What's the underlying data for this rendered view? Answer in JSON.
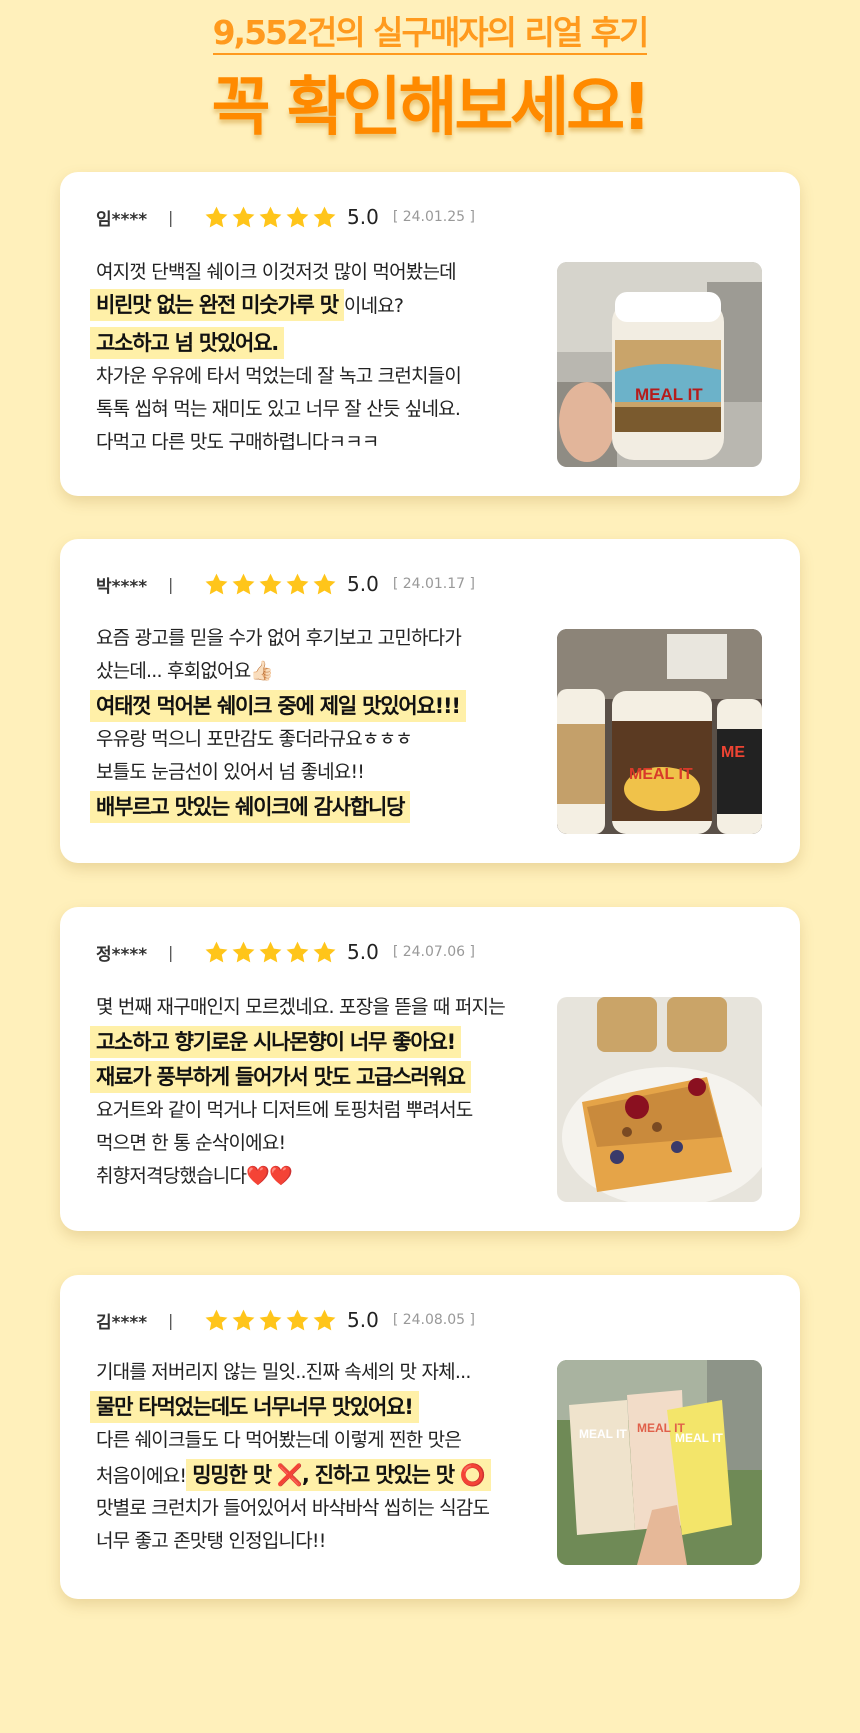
{
  "header": {
    "subtitle": "9,552건의 실구매자의 리얼 후기",
    "title": "꼭 확인해보세요!"
  },
  "colors": {
    "accent": "#ff9a1e",
    "highlight": "#fff0a8",
    "star": "#ffc51a",
    "background": "#fff0bb"
  },
  "reviews": [
    {
      "author": "임****",
      "separator": "|",
      "rating": "5.0",
      "stars": 5,
      "date": "[ 24.01.25 ]",
      "lines": [
        "여지껏 단백질 쉐이크 이것저것 많이 먹어봤는데",
        "비린맛 없는 완전 미숫가루 맛",
        "이네요?",
        "고소하고 넘 맛있어요.",
        "차가운 우유에 타서 먹었는데 잘 녹고 크런치들이",
        "톡톡 씹혀 먹는 재미도 있고 너무 잘 산듯 싶네요.",
        "다먹고 다른 맛도 구매하렵니다ㅋㅋㅋ"
      ],
      "photo_icon": "shake-jar-photo"
    },
    {
      "author": "박****",
      "separator": "|",
      "rating": "5.0",
      "stars": 5,
      "date": "[ 24.01.17 ]",
      "lines": [
        "요즘 광고를 믿을 수가 없어 후기보고 고민하다가",
        "샀는데... 후회없어요",
        "👍🏻",
        "여태껏 먹어본 쉐이크 중에 제일 맛있어요!!!",
        "우유랑 먹으니 포만감도 좋더라규요ㅎㅎㅎ",
        "보틀도 눈금선이 있어서 넘 좋네요!!",
        "배부르고 맛있는 쉐이크에 감사합니당"
      ],
      "photo_icon": "three-jars-photo"
    },
    {
      "author": "정****",
      "separator": "|",
      "rating": "5.0",
      "stars": 5,
      "date": "[ 24.07.06 ]",
      "lines": [
        "몇 번째 재구매인지 모르겠네요. 포장을 뜯을 때 퍼지는",
        "고소하고 향기로운 시나몬향이 너무 좋아요!",
        "재료가 풍부하게 들어가서 맛도 고급스러워요",
        "요거트와 같이 먹거나 디저트에 토핑처럼 뿌려서도",
        "먹으면 한 통 순삭이에요!",
        "취향저격당했습니다",
        "❤️❤️"
      ],
      "photo_icon": "french-toast-photo"
    },
    {
      "author": "김****",
      "separator": "|",
      "rating": "5.0",
      "stars": 5,
      "date": "[ 24.08.05 ]",
      "lines": [
        "기대를 저버리지 않는 밀잇..진짜 속세의 맛 자체...",
        "물만 타먹었는데도 너무너무 맛있어요!",
        "다른 쉐이크들도 다 먹어봤는데 이렇게 찐한 맛은",
        "처음이에요!",
        "밍밍한 맛 ❌, 진하고 맛있는 맛 ⭕",
        "맛별로 크런치가 들어있어서 바삭바삭 씹히는 식감도",
        "너무 좋고 존맛탱 인정입니다!!"
      ],
      "photo_icon": "pouches-photo"
    }
  ]
}
